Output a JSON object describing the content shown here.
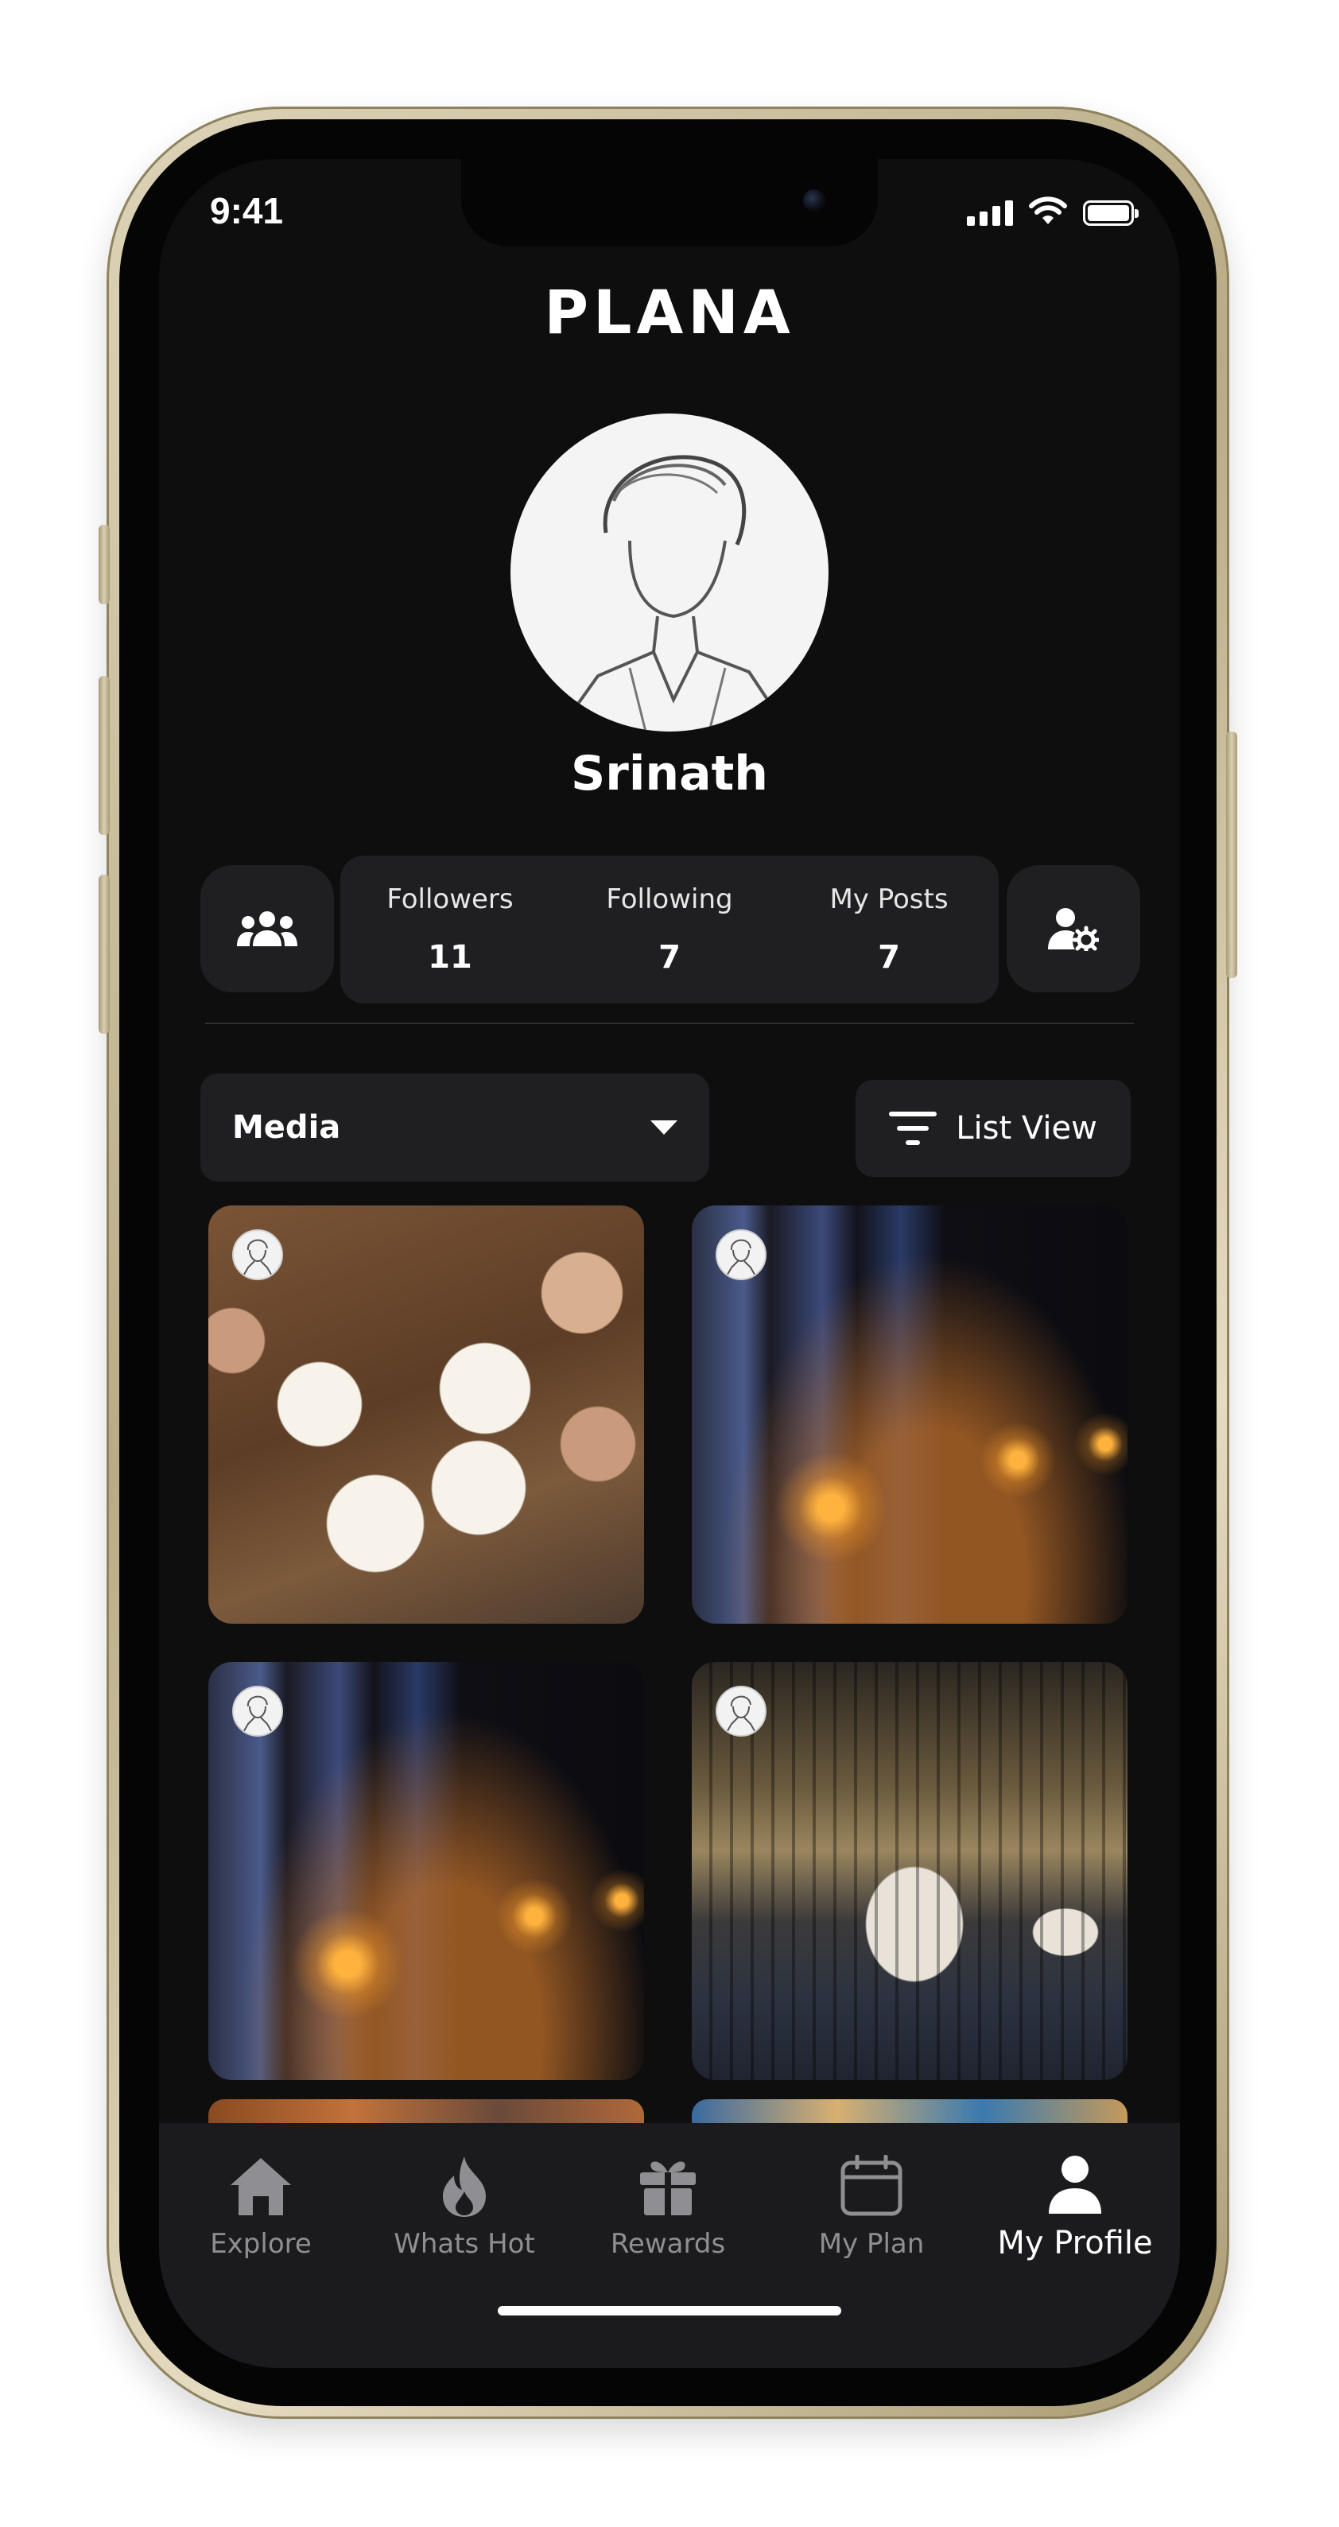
{
  "status_bar": {
    "time": "9:41"
  },
  "app": {
    "logo": "PLANA"
  },
  "profile": {
    "name": "Srinath"
  },
  "stats": [
    {
      "label": "Followers",
      "value": "11"
    },
    {
      "label": "Following",
      "value": "7"
    },
    {
      "label": "My Posts",
      "value": "7"
    }
  ],
  "filters": {
    "media_dropdown_value": "Media",
    "list_view_label": "List View"
  },
  "tabs": [
    {
      "label": "Explore",
      "icon": "home-icon"
    },
    {
      "label": "Whats Hot",
      "icon": "flame-icon"
    },
    {
      "label": "Rewards",
      "icon": "gift-icon"
    },
    {
      "label": "My Plan",
      "icon": "calendar-icon"
    },
    {
      "label": "My Profile",
      "icon": "person-icon",
      "active": true
    }
  ],
  "colors": {
    "background": "#0e0e0e",
    "card": "#1f1f21",
    "tab_inactive": "#8e8e93",
    "tab_active": "#ffffff"
  }
}
